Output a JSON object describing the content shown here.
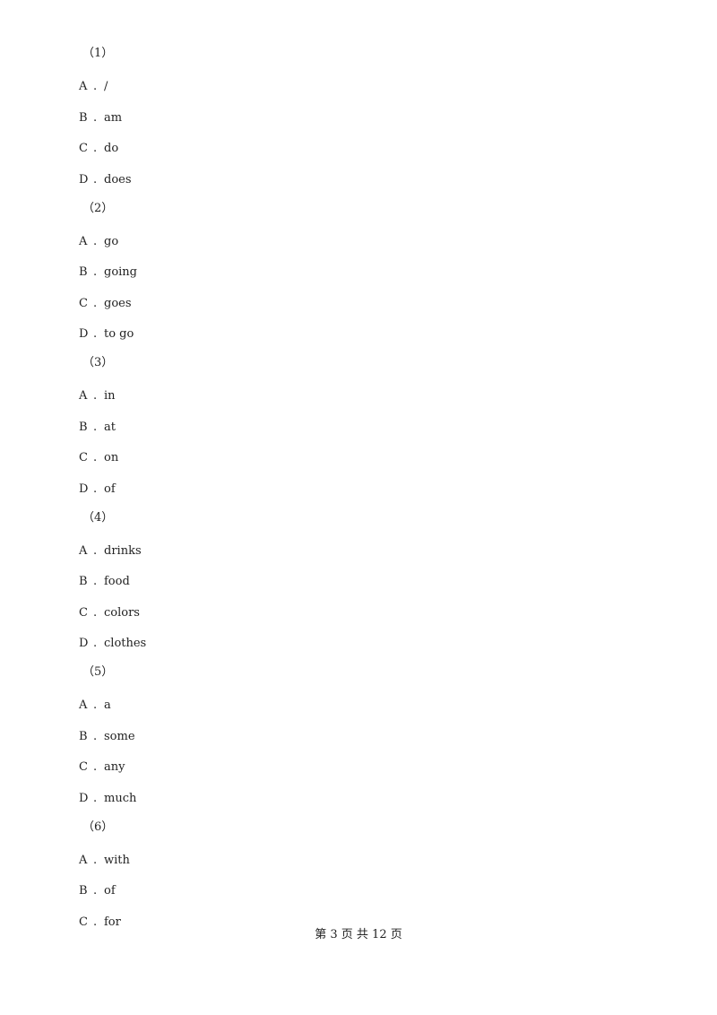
{
  "questions": [
    {
      "number": "（1）",
      "options": [
        {
          "letter": "A",
          "text": "/"
        },
        {
          "letter": "B",
          "text": "am"
        },
        {
          "letter": "C",
          "text": "do"
        },
        {
          "letter": "D",
          "text": "does"
        }
      ]
    },
    {
      "number": "（2）",
      "options": [
        {
          "letter": "A",
          "text": "go"
        },
        {
          "letter": "B",
          "text": "going"
        },
        {
          "letter": "C",
          "text": "goes"
        },
        {
          "letter": "D",
          "text": "to go"
        }
      ]
    },
    {
      "number": "（3）",
      "options": [
        {
          "letter": "A",
          "text": "in"
        },
        {
          "letter": "B",
          "text": "at"
        },
        {
          "letter": "C",
          "text": "on"
        },
        {
          "letter": "D",
          "text": "of"
        }
      ]
    },
    {
      "number": "（4）",
      "options": [
        {
          "letter": "A",
          "text": "drinks"
        },
        {
          "letter": "B",
          "text": "food"
        },
        {
          "letter": "C",
          "text": "colors"
        },
        {
          "letter": "D",
          "text": "clothes"
        }
      ]
    },
    {
      "number": "（5）",
      "options": [
        {
          "letter": "A",
          "text": "a"
        },
        {
          "letter": "B",
          "text": "some"
        },
        {
          "letter": "C",
          "text": "any"
        },
        {
          "letter": "D",
          "text": "much"
        }
      ]
    },
    {
      "number": "（6）",
      "options": [
        {
          "letter": "A",
          "text": "with"
        },
        {
          "letter": "B",
          "text": "of"
        },
        {
          "letter": "C",
          "text": "for"
        }
      ]
    }
  ],
  "separator": ".",
  "footer": "第 3 页 共 12 页"
}
